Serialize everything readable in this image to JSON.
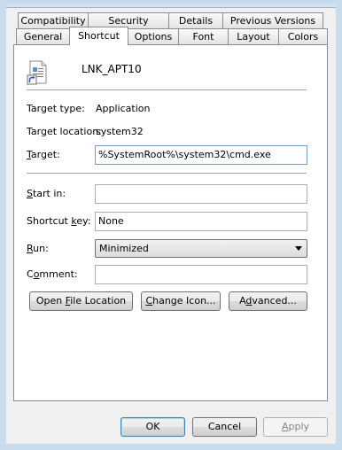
{
  "tabs_row1": [
    {
      "label": "Compatibility"
    },
    {
      "label": "Security"
    },
    {
      "label": "Details"
    },
    {
      "label": "Previous Versions"
    }
  ],
  "tabs_row2": [
    {
      "label": "General"
    },
    {
      "label": "Shortcut"
    },
    {
      "label": "Options"
    },
    {
      "label": "Font"
    },
    {
      "label": "Layout"
    },
    {
      "label": "Colors"
    }
  ],
  "header": {
    "name": "LNK_APT10",
    "icon": "shortcut-file-icon"
  },
  "info": {
    "target_type_label": "Target type:",
    "target_type_value": "Application",
    "target_location_label": "Target location:",
    "target_location_value": "system32"
  },
  "fields": {
    "target_label_accel": "T",
    "target_label_rest": "arget:",
    "target_value": "%SystemRoot%\\system32\\cmd.exe",
    "start_in_label_accel": "S",
    "start_in_label_rest": "tart in:",
    "start_in_value": "",
    "shortcut_key_label_pre": "Shortcut ",
    "shortcut_key_label_accel": "k",
    "shortcut_key_label_post": "ey:",
    "shortcut_key_value": "None",
    "run_label_accel": "R",
    "run_label_rest": "un:",
    "run_value": "Minimized",
    "comment_label_pre": "C",
    "comment_label_accel": "o",
    "comment_label_post": "mment:",
    "comment_value": ""
  },
  "actions": {
    "open_pre": "Open ",
    "open_accel": "F",
    "open_post": "ile Location",
    "change_accel": "C",
    "change_post": "hange Icon...",
    "adv_pre": "A",
    "adv_accel": "d",
    "adv_post": "vanced..."
  },
  "footer": {
    "ok": "OK",
    "cancel": "Cancel",
    "apply_accel": "A",
    "apply_post": "pply"
  },
  "colors": {
    "background": "#f0f0f0",
    "panel": "#ffffff",
    "border": "#898c95",
    "frame": "#c9dcec"
  }
}
